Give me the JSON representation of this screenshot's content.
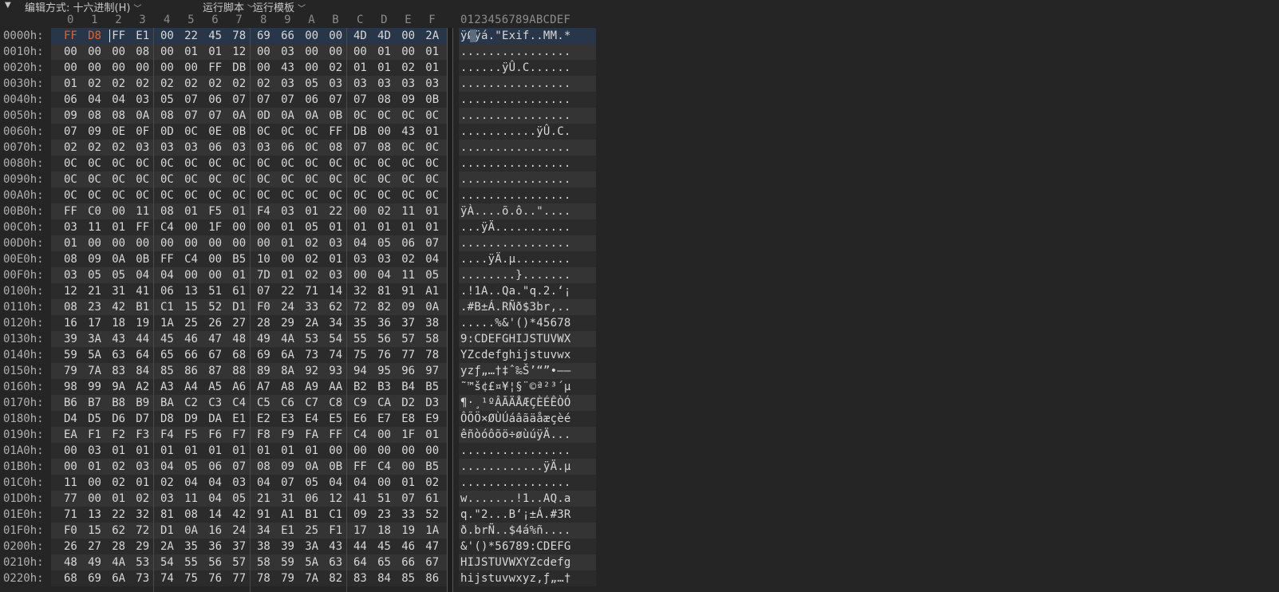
{
  "toolbar": {
    "edit_mode_label": "编辑方式:",
    "edit_mode_value": "十六进制(H)",
    "run_script": "运行脚本",
    "run_template": "运行模板"
  },
  "column_headers": [
    "0",
    "1",
    "2",
    "3",
    "4",
    "5",
    "6",
    "7",
    "8",
    "9",
    "A",
    "B",
    "C",
    "D",
    "E",
    "F"
  ],
  "text_header": "0123456789ABCDEF",
  "selected_row": 0,
  "highlighted_bytes": [
    0,
    1
  ],
  "colors": {
    "background": "#252525",
    "highlight_byte": "#e0622f",
    "selection": "#28364a"
  },
  "rows": [
    {
      "addr": "0000h:",
      "hex": [
        "FF",
        "D8",
        "FF",
        "E1",
        "00",
        "22",
        "45",
        "78",
        "69",
        "66",
        "00",
        "00",
        "4D",
        "4D",
        "00",
        "2A"
      ],
      "text": "ÿØÿá.\"Exif..MM.*"
    },
    {
      "addr": "0010h:",
      "hex": [
        "00",
        "00",
        "00",
        "08",
        "00",
        "01",
        "01",
        "12",
        "00",
        "03",
        "00",
        "00",
        "00",
        "01",
        "00",
        "01"
      ],
      "text": "................"
    },
    {
      "addr": "0020h:",
      "hex": [
        "00",
        "00",
        "00",
        "00",
        "00",
        "00",
        "FF",
        "DB",
        "00",
        "43",
        "00",
        "02",
        "01",
        "01",
        "02",
        "01"
      ],
      "text": "......ÿÛ.C......"
    },
    {
      "addr": "0030h:",
      "hex": [
        "01",
        "02",
        "02",
        "02",
        "02",
        "02",
        "02",
        "02",
        "02",
        "03",
        "05",
        "03",
        "03",
        "03",
        "03",
        "03"
      ],
      "text": "................"
    },
    {
      "addr": "0040h:",
      "hex": [
        "06",
        "04",
        "04",
        "03",
        "05",
        "07",
        "06",
        "07",
        "07",
        "07",
        "06",
        "07",
        "07",
        "08",
        "09",
        "0B"
      ],
      "text": "................"
    },
    {
      "addr": "0050h:",
      "hex": [
        "09",
        "08",
        "08",
        "0A",
        "08",
        "07",
        "07",
        "0A",
        "0D",
        "0A",
        "0A",
        "0B",
        "0C",
        "0C",
        "0C",
        "0C"
      ],
      "text": "................"
    },
    {
      "addr": "0060h:",
      "hex": [
        "07",
        "09",
        "0E",
        "0F",
        "0D",
        "0C",
        "0E",
        "0B",
        "0C",
        "0C",
        "0C",
        "FF",
        "DB",
        "00",
        "43",
        "01"
      ],
      "text": "...........ÿÛ.C."
    },
    {
      "addr": "0070h:",
      "hex": [
        "02",
        "02",
        "02",
        "03",
        "03",
        "03",
        "06",
        "03",
        "03",
        "06",
        "0C",
        "08",
        "07",
        "08",
        "0C",
        "0C"
      ],
      "text": "................"
    },
    {
      "addr": "0080h:",
      "hex": [
        "0C",
        "0C",
        "0C",
        "0C",
        "0C",
        "0C",
        "0C",
        "0C",
        "0C",
        "0C",
        "0C",
        "0C",
        "0C",
        "0C",
        "0C",
        "0C"
      ],
      "text": "................"
    },
    {
      "addr": "0090h:",
      "hex": [
        "0C",
        "0C",
        "0C",
        "0C",
        "0C",
        "0C",
        "0C",
        "0C",
        "0C",
        "0C",
        "0C",
        "0C",
        "0C",
        "0C",
        "0C",
        "0C"
      ],
      "text": "................"
    },
    {
      "addr": "00A0h:",
      "hex": [
        "0C",
        "0C",
        "0C",
        "0C",
        "0C",
        "0C",
        "0C",
        "0C",
        "0C",
        "0C",
        "0C",
        "0C",
        "0C",
        "0C",
        "0C",
        "0C"
      ],
      "text": "................"
    },
    {
      "addr": "00B0h:",
      "hex": [
        "FF",
        "C0",
        "00",
        "11",
        "08",
        "01",
        "F5",
        "01",
        "F4",
        "03",
        "01",
        "22",
        "00",
        "02",
        "11",
        "01"
      ],
      "text": "ÿÀ....õ.ô..\"...."
    },
    {
      "addr": "00C0h:",
      "hex": [
        "03",
        "11",
        "01",
        "FF",
        "C4",
        "00",
        "1F",
        "00",
        "00",
        "01",
        "05",
        "01",
        "01",
        "01",
        "01",
        "01"
      ],
      "text": "...ÿÄ..........."
    },
    {
      "addr": "00D0h:",
      "hex": [
        "01",
        "00",
        "00",
        "00",
        "00",
        "00",
        "00",
        "00",
        "00",
        "01",
        "02",
        "03",
        "04",
        "05",
        "06",
        "07"
      ],
      "text": "................"
    },
    {
      "addr": "00E0h:",
      "hex": [
        "08",
        "09",
        "0A",
        "0B",
        "FF",
        "C4",
        "00",
        "B5",
        "10",
        "00",
        "02",
        "01",
        "03",
        "03",
        "02",
        "04"
      ],
      "text": "....ÿÄ.µ........"
    },
    {
      "addr": "00F0h:",
      "hex": [
        "03",
        "05",
        "05",
        "04",
        "04",
        "00",
        "00",
        "01",
        "7D",
        "01",
        "02",
        "03",
        "00",
        "04",
        "11",
        "05"
      ],
      "text": "........}......."
    },
    {
      "addr": "0100h:",
      "hex": [
        "12",
        "21",
        "31",
        "41",
        "06",
        "13",
        "51",
        "61",
        "07",
        "22",
        "71",
        "14",
        "32",
        "81",
        "91",
        "A1"
      ],
      "text": ".!1A..Qa.\"q.2.‘¡"
    },
    {
      "addr": "0110h:",
      "hex": [
        "08",
        "23",
        "42",
        "B1",
        "C1",
        "15",
        "52",
        "D1",
        "F0",
        "24",
        "33",
        "62",
        "72",
        "82",
        "09",
        "0A"
      ],
      "text": ".#B±Á.RÑð$3br,.."
    },
    {
      "addr": "0120h:",
      "hex": [
        "16",
        "17",
        "18",
        "19",
        "1A",
        "25",
        "26",
        "27",
        "28",
        "29",
        "2A",
        "34",
        "35",
        "36",
        "37",
        "38"
      ],
      "text": ".....%&'()*45678"
    },
    {
      "addr": "0130h:",
      "hex": [
        "39",
        "3A",
        "43",
        "44",
        "45",
        "46",
        "47",
        "48",
        "49",
        "4A",
        "53",
        "54",
        "55",
        "56",
        "57",
        "58"
      ],
      "text": "9:CDEFGHIJSTUVWX"
    },
    {
      "addr": "0140h:",
      "hex": [
        "59",
        "5A",
        "63",
        "64",
        "65",
        "66",
        "67",
        "68",
        "69",
        "6A",
        "73",
        "74",
        "75",
        "76",
        "77",
        "78"
      ],
      "text": "YZcdefghijstuvwx"
    },
    {
      "addr": "0150h:",
      "hex": [
        "79",
        "7A",
        "83",
        "84",
        "85",
        "86",
        "87",
        "88",
        "89",
        "8A",
        "92",
        "93",
        "94",
        "95",
        "96",
        "97"
      ],
      "text": "yzƒ„…†‡ˆ‰Š’“”•–—"
    },
    {
      "addr": "0160h:",
      "hex": [
        "98",
        "99",
        "9A",
        "A2",
        "A3",
        "A4",
        "A5",
        "A6",
        "A7",
        "A8",
        "A9",
        "AA",
        "B2",
        "B3",
        "B4",
        "B5"
      ],
      "text": "˜™š¢£¤¥¦§¨©ª²³´µ"
    },
    {
      "addr": "0170h:",
      "hex": [
        "B6",
        "B7",
        "B8",
        "B9",
        "BA",
        "C2",
        "C3",
        "C4",
        "C5",
        "C6",
        "C7",
        "C8",
        "C9",
        "CA",
        "D2",
        "D3"
      ],
      "text": "¶·¸¹ºÂÃÄÅÆÇÈÉÊÒÓ"
    },
    {
      "addr": "0180h:",
      "hex": [
        "D4",
        "D5",
        "D6",
        "D7",
        "D8",
        "D9",
        "DA",
        "E1",
        "E2",
        "E3",
        "E4",
        "E5",
        "E6",
        "E7",
        "E8",
        "E9"
      ],
      "text": "ÔÕÖ×ØÙÚáâãäåæçèé"
    },
    {
      "addr": "0190h:",
      "hex": [
        "EA",
        "F1",
        "F2",
        "F3",
        "F4",
        "F5",
        "F6",
        "F7",
        "F8",
        "F9",
        "FA",
        "FF",
        "C4",
        "00",
        "1F",
        "01"
      ],
      "text": "êñòóôõö÷øùúÿÄ..."
    },
    {
      "addr": "01A0h:",
      "hex": [
        "00",
        "03",
        "01",
        "01",
        "01",
        "01",
        "01",
        "01",
        "01",
        "01",
        "01",
        "00",
        "00",
        "00",
        "00",
        "00"
      ],
      "text": "................"
    },
    {
      "addr": "01B0h:",
      "hex": [
        "00",
        "01",
        "02",
        "03",
        "04",
        "05",
        "06",
        "07",
        "08",
        "09",
        "0A",
        "0B",
        "FF",
        "C4",
        "00",
        "B5"
      ],
      "text": "............ÿÄ.µ"
    },
    {
      "addr": "01C0h:",
      "hex": [
        "11",
        "00",
        "02",
        "01",
        "02",
        "04",
        "04",
        "03",
        "04",
        "07",
        "05",
        "04",
        "04",
        "00",
        "01",
        "02"
      ],
      "text": "................"
    },
    {
      "addr": "01D0h:",
      "hex": [
        "77",
        "00",
        "01",
        "02",
        "03",
        "11",
        "04",
        "05",
        "21",
        "31",
        "06",
        "12",
        "41",
        "51",
        "07",
        "61"
      ],
      "text": "w.......!1..AQ.a"
    },
    {
      "addr": "01E0h:",
      "hex": [
        "71",
        "13",
        "22",
        "32",
        "81",
        "08",
        "14",
        "42",
        "91",
        "A1",
        "B1",
        "C1",
        "09",
        "23",
        "33",
        "52"
      ],
      "text": "q.\"2...B‘¡±Á.#3R"
    },
    {
      "addr": "01F0h:",
      "hex": [
        "F0",
        "15",
        "62",
        "72",
        "D1",
        "0A",
        "16",
        "24",
        "34",
        "E1",
        "25",
        "F1",
        "17",
        "18",
        "19",
        "1A"
      ],
      "text": "ð.brÑ..$4á%ñ...."
    },
    {
      "addr": "0200h:",
      "hex": [
        "26",
        "27",
        "28",
        "29",
        "2A",
        "35",
        "36",
        "37",
        "38",
        "39",
        "3A",
        "43",
        "44",
        "45",
        "46",
        "47"
      ],
      "text": "&'()*56789:CDEFG"
    },
    {
      "addr": "0210h:",
      "hex": [
        "48",
        "49",
        "4A",
        "53",
        "54",
        "55",
        "56",
        "57",
        "58",
        "59",
        "5A",
        "63",
        "64",
        "65",
        "66",
        "67"
      ],
      "text": "HIJSTUVWXYZcdefg"
    },
    {
      "addr": "0220h:",
      "hex": [
        "68",
        "69",
        "6A",
        "73",
        "74",
        "75",
        "76",
        "77",
        "78",
        "79",
        "7A",
        "82",
        "83",
        "84",
        "85",
        "86"
      ],
      "text": "hijstuvwxyz‚ƒ„…†"
    }
  ]
}
